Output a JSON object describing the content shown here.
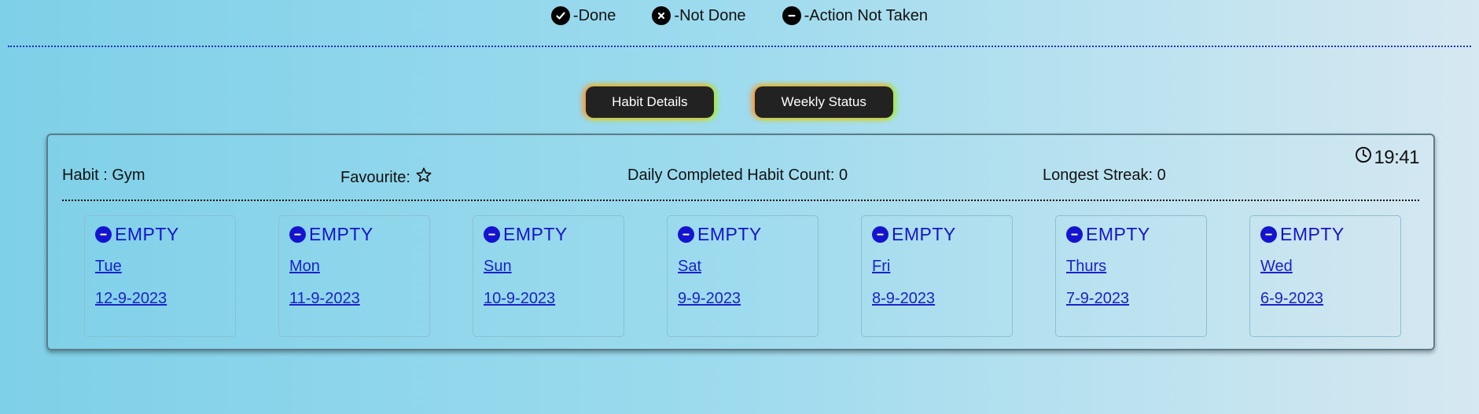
{
  "legend": {
    "done_label": "-Done",
    "not_done_label": "-Not Done",
    "no_action_label": "-Action Not Taken"
  },
  "buttons": {
    "habit_details": "Habit Details",
    "weekly_status": "Weekly Status"
  },
  "habit": {
    "name_label": "Habit : Gym",
    "favourite_label": "Favourite:",
    "daily_count_label": "Daily Completed Habit Count: 0",
    "longest_streak_label": "Longest Streak: 0",
    "time": "19:41"
  },
  "days": [
    {
      "status": "EMPTY",
      "day": "Tue",
      "date": "12-9-2023"
    },
    {
      "status": "EMPTY",
      "day": "Mon",
      "date": "11-9-2023"
    },
    {
      "status": "EMPTY",
      "day": "Sun",
      "date": "10-9-2023"
    },
    {
      "status": "EMPTY",
      "day": "Sat",
      "date": "9-9-2023"
    },
    {
      "status": "EMPTY",
      "day": "Fri",
      "date": "8-9-2023"
    },
    {
      "status": "EMPTY",
      "day": "Thurs",
      "date": "7-9-2023"
    },
    {
      "status": "EMPTY",
      "day": "Wed",
      "date": "6-9-2023"
    }
  ],
  "colors": {
    "status_empty": "#1414d0",
    "link": "#1a22cc",
    "button_bg": "#222222"
  }
}
